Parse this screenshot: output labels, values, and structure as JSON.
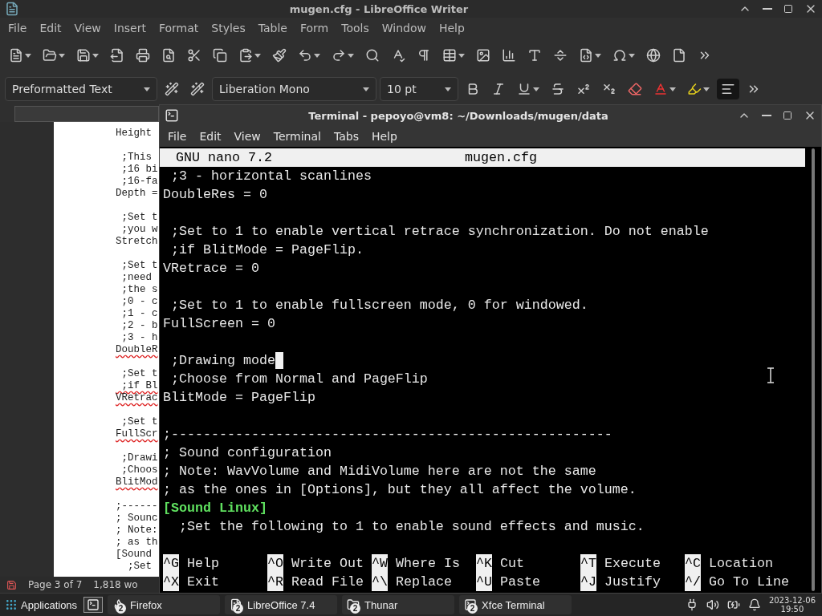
{
  "writer": {
    "title": "mugen.cfg - LibreOffice Writer",
    "menu": [
      "File",
      "Edit",
      "View",
      "Insert",
      "Format",
      "Styles",
      "Table",
      "Form",
      "Tools",
      "Window",
      "Help"
    ],
    "toolbar": [
      {
        "dropdown": true
      },
      {
        "dropdown": true
      },
      {
        "dropdown": true
      },
      {
        "dropdown": false
      },
      {
        "dropdown": false
      },
      {
        "dropdown": false
      },
      {
        "dropdown": false
      },
      {
        "dropdown": false
      },
      {
        "dropdown": true
      },
      {
        "dropdown": false
      },
      {
        "dropdown": true
      },
      {
        "dropdown": true
      },
      {
        "dropdown": false
      },
      {
        "dropdown": false
      },
      {
        "dropdown": false
      },
      {
        "dropdown": true
      },
      {
        "dropdown": false
      },
      {
        "dropdown": false
      },
      {
        "dropdown": false
      },
      {
        "dropdown": false
      },
      {
        "dropdown": true
      },
      {
        "dropdown": true
      },
      {
        "dropdown": false
      },
      {
        "dropdown": false
      }
    ],
    "paragraph_style": "Preformatted Text",
    "font_name": "Liberation Mono",
    "font_size": "10 pt",
    "format_buttons": [
      {
        "dropdown": false,
        "selected": false
      },
      {
        "dropdown": false,
        "selected": false
      },
      {
        "dropdown": true,
        "selected": false
      },
      {
        "dropdown": false,
        "selected": false
      },
      {
        "dropdown": false,
        "selected": false
      },
      {
        "dropdown": false,
        "selected": false
      },
      {
        "dropdown": false,
        "selected": false
      },
      {
        "dropdown": true,
        "selected": false
      },
      {
        "dropdown": true,
        "selected": false
      },
      {
        "dropdown": false,
        "selected": true
      }
    ],
    "document": [
      [
        {
          "text": "Height",
          "misspelled": false
        }
      ],
      [
        {
          "text": " ;This",
          "misspelled": false
        },
        {
          "text": " ;16 bi",
          "misspelled": false
        },
        {
          "text": " ;16-fa",
          "misspelled": false
        },
        {
          "text": "Depth =",
          "misspelled": false
        }
      ],
      [
        {
          "text": " ;Set t",
          "misspelled": false
        },
        {
          "text": " ;you w",
          "misspelled": false
        },
        {
          "text": "Stretch",
          "misspelled": false
        }
      ],
      [
        {
          "text": " ;Set t",
          "misspelled": false
        },
        {
          "text": " ;need",
          "misspelled": false
        },
        {
          "text": " ;the s",
          "misspelled": false
        },
        {
          "text": " ;0 - c",
          "misspelled": false
        },
        {
          "text": " ;1 - c",
          "misspelled": false
        },
        {
          "text": " ;2 - b",
          "misspelled": false
        },
        {
          "text": " ;3 - h",
          "misspelled": false
        },
        {
          "text": "DoubleR",
          "misspelled": true
        }
      ],
      [
        {
          "text": " ;Set t",
          "misspelled": false
        },
        {
          "text": " ;if Bl",
          "misspelled": true
        },
        {
          "text": "VRetrac",
          "misspelled": true
        }
      ],
      [
        {
          "text": " ;Set t",
          "misspelled": false
        },
        {
          "text": "FullScr",
          "misspelled": true
        }
      ],
      [
        {
          "text": " ;Drawi",
          "misspelled": false
        },
        {
          "text": " ;Choos",
          "misspelled": false
        },
        {
          "text": "BlitMod",
          "misspelled": true
        }
      ],
      [
        {
          "text": ";------",
          "misspelled": false
        },
        {
          "text": "; Sounc",
          "misspelled": false
        },
        {
          "text": "; Note:",
          "misspelled": false
        },
        {
          "text": "; as th",
          "misspelled": false
        },
        {
          "text": "[Sound",
          "misspelled": false
        },
        {
          "text": "  ;Set",
          "misspelled": false
        }
      ]
    ],
    "status": {
      "page": "Page 3 of 7",
      "words": "1,818 wo"
    }
  },
  "terminal": {
    "title": "Terminal - pepoyo@vm8: ~/Downloads/mugen/data",
    "menu": [
      "File",
      "Edit",
      "View",
      "Terminal",
      "Tabs",
      "Help"
    ],
    "editor_name": "GNU nano 7.2",
    "file_name": "mugen.cfg",
    "blocks": [
      [
        {
          "text": " ;3 - horizontal scanlines",
          "kind": "text",
          "cursor": false
        },
        {
          "text": "DoubleRes = 0",
          "kind": "text",
          "cursor": false
        }
      ],
      [
        {
          "text": " ;Set to 1 to enable vertical retrace synchronization. Do not enable",
          "kind": "text",
          "cursor": false
        },
        {
          "text": " ;if BlitMode = PageFlip.",
          "kind": "text",
          "cursor": false
        },
        {
          "text": "VRetrace = 0",
          "kind": "text",
          "cursor": false
        }
      ],
      [
        {
          "text": " ;Set to 1 to enable fullscreen mode, 0 for windowed.",
          "kind": "text",
          "cursor": false
        },
        {
          "text": "FullScreen = 0",
          "kind": "text",
          "cursor": false
        }
      ],
      [
        {
          "text": " ;Drawing mode",
          "kind": "text",
          "cursor": true
        },
        {
          "text": " ;Choose from Normal and PageFlip",
          "kind": "text",
          "cursor": false
        },
        {
          "text": "BlitMode = PageFlip",
          "kind": "text",
          "cursor": false
        }
      ],
      [
        {
          "text": ";-------------------------------------------------------",
          "kind": "text",
          "cursor": false
        },
        {
          "text": "; Sound configuration",
          "kind": "text",
          "cursor": false
        },
        {
          "text": "; Note: WavVolume and MidiVolume here are not the same",
          "kind": "text",
          "cursor": false
        },
        {
          "text": "; as the ones in [Options], but they all affect the volume.",
          "kind": "text",
          "cursor": false
        },
        {
          "text": "[Sound Linux]",
          "kind": "section",
          "cursor": false
        },
        {
          "text": "  ;Set the following to 1 to enable sound effects and music.",
          "kind": "text",
          "cursor": false
        }
      ]
    ],
    "shortcuts": [
      {
        "key": "^G",
        "label": "Help"
      },
      {
        "key": "^O",
        "label": "Write Out"
      },
      {
        "key": "^W",
        "label": "Where Is"
      },
      {
        "key": "^K",
        "label": "Cut"
      },
      {
        "key": "^T",
        "label": "Execute"
      },
      {
        "key": "^C",
        "label": "Location"
      },
      {
        "key": "^X",
        "label": "Exit"
      },
      {
        "key": "^R",
        "label": "Read File"
      },
      {
        "key": "^\\",
        "label": "Replace"
      },
      {
        "key": "^U",
        "label": "Paste"
      },
      {
        "key": "^J",
        "label": "Justify"
      },
      {
        "key": "^/",
        "label": "Go To Line"
      }
    ]
  },
  "taskbar": {
    "menu": "Applications",
    "tasks": [
      {
        "label": "Firefox",
        "count": "2"
      },
      {
        "label": "LibreOffice 7.4",
        "count": "2"
      },
      {
        "label": "Thunar",
        "count": "2"
      },
      {
        "label": "Xfce Terminal",
        "count": "2"
      }
    ],
    "date": "2023-12-06",
    "time": "19:50"
  }
}
